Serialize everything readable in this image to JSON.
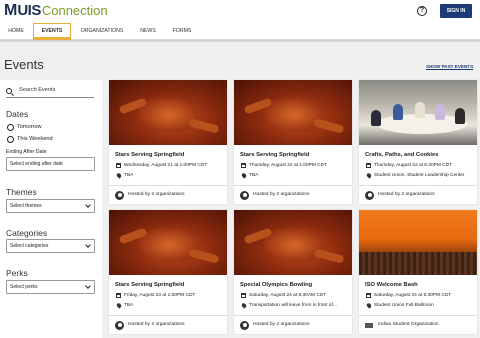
{
  "brand": {
    "m": "M",
    "uis": "UIS",
    "connection": "Connection"
  },
  "header": {
    "help_glyph": "?",
    "signin_label": "SIGN IN"
  },
  "nav": {
    "items": [
      {
        "label": "HOME"
      },
      {
        "label": "EVENTS"
      },
      {
        "label": "ORGANIZATIONS"
      },
      {
        "label": "NEWS"
      },
      {
        "label": "FORMS"
      }
    ],
    "active": "EVENTS"
  },
  "page": {
    "title": "Events",
    "past_link": "SHOW PAST EVENTS"
  },
  "sidebar": {
    "search_placeholder": "Search Events",
    "dates_heading": "Dates",
    "options": [
      "Tomorrow",
      "This Weekend"
    ],
    "ending_after_label": "Ending After Date",
    "ending_after_placeholder": "Select ending after date",
    "themes_heading": "Themes",
    "themes_select": "Select themes",
    "categories_heading": "Categories",
    "categories_select": "Select categories",
    "perks_heading": "Perks",
    "perks_select": "Select perks"
  },
  "events": [
    {
      "title": "Stars Serving Springfield",
      "date": "Wednesday, August 21 at 1:00PM CDT",
      "location": "TBA",
      "host": "Hosted by 2 organizations",
      "image": "hands"
    },
    {
      "title": "Stars Serving Springfield",
      "date": "Thursday, August 22 at 1:00PM CDT",
      "location": "TBA",
      "host": "Hosted by 2 organizations",
      "image": "hands"
    },
    {
      "title": "Crafts, Paths, and Cookies",
      "date": "Thursday, August 22 at 5:30PM CDT",
      "location": "Student Union, Student Leadership Center",
      "host": "Hosted by 2 organizations",
      "image": "group"
    },
    {
      "title": "Stars Serving Springfield",
      "date": "Friday, August 23 at 1:00PM CDT",
      "location": "TBA",
      "host": "Hosted by 2 organizations",
      "image": "hands"
    },
    {
      "title": "Special Olympics Bowling",
      "date": "Saturday, August 24 at 8:30AM CDT",
      "location": "Transportation will leave from in front of...",
      "host": "Hosted by 2 organizations",
      "image": "hands"
    },
    {
      "title": "ISO Welcome Bash",
      "date": "Saturday, August 24 at 5:30PM CDT",
      "location": "Student Union Full Ballroom",
      "host": "Indian Student Organization",
      "image": "orange"
    }
  ]
}
